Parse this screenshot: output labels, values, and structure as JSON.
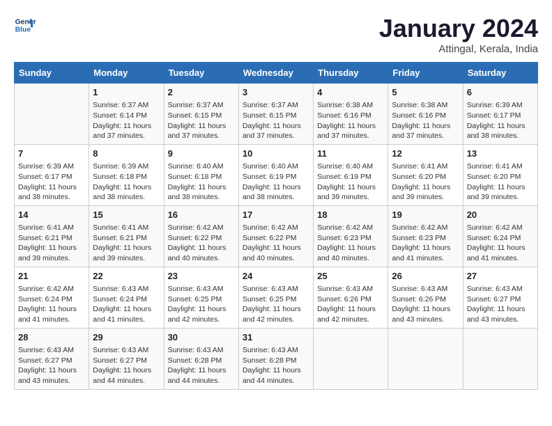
{
  "header": {
    "logo_line1": "General",
    "logo_line2": "Blue",
    "month": "January 2024",
    "location": "Attingal, Kerala, India"
  },
  "columns": [
    "Sunday",
    "Monday",
    "Tuesday",
    "Wednesday",
    "Thursday",
    "Friday",
    "Saturday"
  ],
  "weeks": [
    [
      {
        "day": "",
        "info": ""
      },
      {
        "day": "1",
        "info": "Sunrise: 6:37 AM\nSunset: 6:14 PM\nDaylight: 11 hours and 37 minutes."
      },
      {
        "day": "2",
        "info": "Sunrise: 6:37 AM\nSunset: 6:15 PM\nDaylight: 11 hours and 37 minutes."
      },
      {
        "day": "3",
        "info": "Sunrise: 6:37 AM\nSunset: 6:15 PM\nDaylight: 11 hours and 37 minutes."
      },
      {
        "day": "4",
        "info": "Sunrise: 6:38 AM\nSunset: 6:16 PM\nDaylight: 11 hours and 37 minutes."
      },
      {
        "day": "5",
        "info": "Sunrise: 6:38 AM\nSunset: 6:16 PM\nDaylight: 11 hours and 37 minutes."
      },
      {
        "day": "6",
        "info": "Sunrise: 6:39 AM\nSunset: 6:17 PM\nDaylight: 11 hours and 38 minutes."
      }
    ],
    [
      {
        "day": "7",
        "info": "Sunrise: 6:39 AM\nSunset: 6:17 PM\nDaylight: 11 hours and 38 minutes."
      },
      {
        "day": "8",
        "info": "Sunrise: 6:39 AM\nSunset: 6:18 PM\nDaylight: 11 hours and 38 minutes."
      },
      {
        "day": "9",
        "info": "Sunrise: 6:40 AM\nSunset: 6:18 PM\nDaylight: 11 hours and 38 minutes."
      },
      {
        "day": "10",
        "info": "Sunrise: 6:40 AM\nSunset: 6:19 PM\nDaylight: 11 hours and 38 minutes."
      },
      {
        "day": "11",
        "info": "Sunrise: 6:40 AM\nSunset: 6:19 PM\nDaylight: 11 hours and 39 minutes."
      },
      {
        "day": "12",
        "info": "Sunrise: 6:41 AM\nSunset: 6:20 PM\nDaylight: 11 hours and 39 minutes."
      },
      {
        "day": "13",
        "info": "Sunrise: 6:41 AM\nSunset: 6:20 PM\nDaylight: 11 hours and 39 minutes."
      }
    ],
    [
      {
        "day": "14",
        "info": "Sunrise: 6:41 AM\nSunset: 6:21 PM\nDaylight: 11 hours and 39 minutes."
      },
      {
        "day": "15",
        "info": "Sunrise: 6:41 AM\nSunset: 6:21 PM\nDaylight: 11 hours and 39 minutes."
      },
      {
        "day": "16",
        "info": "Sunrise: 6:42 AM\nSunset: 6:22 PM\nDaylight: 11 hours and 40 minutes."
      },
      {
        "day": "17",
        "info": "Sunrise: 6:42 AM\nSunset: 6:22 PM\nDaylight: 11 hours and 40 minutes."
      },
      {
        "day": "18",
        "info": "Sunrise: 6:42 AM\nSunset: 6:23 PM\nDaylight: 11 hours and 40 minutes."
      },
      {
        "day": "19",
        "info": "Sunrise: 6:42 AM\nSunset: 6:23 PM\nDaylight: 11 hours and 41 minutes."
      },
      {
        "day": "20",
        "info": "Sunrise: 6:42 AM\nSunset: 6:24 PM\nDaylight: 11 hours and 41 minutes."
      }
    ],
    [
      {
        "day": "21",
        "info": "Sunrise: 6:42 AM\nSunset: 6:24 PM\nDaylight: 11 hours and 41 minutes."
      },
      {
        "day": "22",
        "info": "Sunrise: 6:43 AM\nSunset: 6:24 PM\nDaylight: 11 hours and 41 minutes."
      },
      {
        "day": "23",
        "info": "Sunrise: 6:43 AM\nSunset: 6:25 PM\nDaylight: 11 hours and 42 minutes."
      },
      {
        "day": "24",
        "info": "Sunrise: 6:43 AM\nSunset: 6:25 PM\nDaylight: 11 hours and 42 minutes."
      },
      {
        "day": "25",
        "info": "Sunrise: 6:43 AM\nSunset: 6:26 PM\nDaylight: 11 hours and 42 minutes."
      },
      {
        "day": "26",
        "info": "Sunrise: 6:43 AM\nSunset: 6:26 PM\nDaylight: 11 hours and 43 minutes."
      },
      {
        "day": "27",
        "info": "Sunrise: 6:43 AM\nSunset: 6:27 PM\nDaylight: 11 hours and 43 minutes."
      }
    ],
    [
      {
        "day": "28",
        "info": "Sunrise: 6:43 AM\nSunset: 6:27 PM\nDaylight: 11 hours and 43 minutes."
      },
      {
        "day": "29",
        "info": "Sunrise: 6:43 AM\nSunset: 6:27 PM\nDaylight: 11 hours and 44 minutes."
      },
      {
        "day": "30",
        "info": "Sunrise: 6:43 AM\nSunset: 6:28 PM\nDaylight: 11 hours and 44 minutes."
      },
      {
        "day": "31",
        "info": "Sunrise: 6:43 AM\nSunset: 6:28 PM\nDaylight: 11 hours and 44 minutes."
      },
      {
        "day": "",
        "info": ""
      },
      {
        "day": "",
        "info": ""
      },
      {
        "day": "",
        "info": ""
      }
    ]
  ]
}
